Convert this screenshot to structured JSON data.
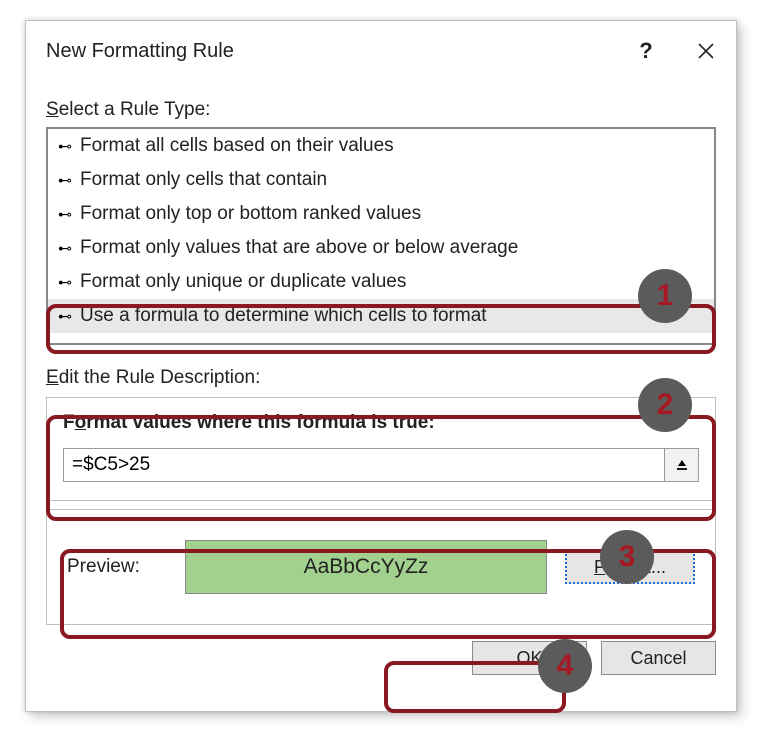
{
  "dialog": {
    "title": "New Formatting Rule"
  },
  "select_label_underline": "S",
  "select_label_rest": "elect a Rule Type:",
  "rule_types": [
    "Format all cells based on their values",
    "Format only cells that contain",
    "Format only top or bottom ranked values",
    "Format only values that are above or below average",
    "Format only unique or duplicate values",
    "Use a formula to determine which cells to format"
  ],
  "edit_label_underline": "E",
  "edit_label_rest": "dit the Rule Description:",
  "formula_heading_pre": "F",
  "formula_heading_underline": "o",
  "formula_heading_post": "rmat values where this formula is true:",
  "formula_value": "=$C5>25",
  "preview_label": "Preview:",
  "preview_sample": "AaBbCcYyZz",
  "format_btn_underline": "F",
  "format_btn_rest": "ormat...",
  "ok_label": "OK",
  "cancel_label": "Cancel",
  "annotations": {
    "1": "1",
    "2": "2",
    "3": "3",
    "4": "4"
  }
}
